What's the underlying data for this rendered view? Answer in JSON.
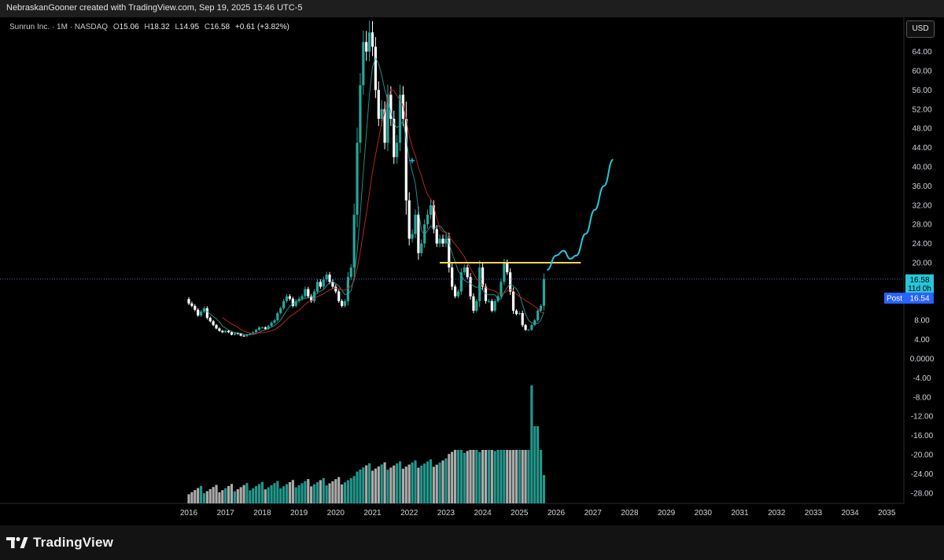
{
  "header": {
    "caption": "NebraskanGooner created with TradingView.com, Sep 19, 2025 15:46 UTC-5"
  },
  "legend": {
    "symbol": "Sunrun Inc. · 1M · NASDAQ",
    "open_label": "O",
    "open": "15.06",
    "high_label": "H",
    "high": "18.32",
    "low_label": "L",
    "low": "14.95",
    "close_label": "C",
    "close": "16.58",
    "change": "+0.61 (+3.82%)"
  },
  "currency_button": "USD",
  "brand": {
    "name": "TradingView",
    "icon": "tradingview-logo-icon"
  },
  "colors": {
    "up": "#26a69a",
    "down": "#ffffff",
    "bg": "#000000",
    "ma_fast": "#26a69a",
    "ma_slow": "#c62828",
    "resistance": "#ffd54f",
    "projection": "#26c6da",
    "last_price_badge": "#26c6da",
    "post_badge": "#2962ff"
  },
  "chart_data": {
    "type": "candlestick",
    "symbol": "Sunrun Inc.",
    "interval": "1M",
    "exchange": "NASDAQ",
    "currency": "USD",
    "y_ticks": [
      64,
      60,
      56,
      52,
      48,
      44,
      40,
      36,
      32,
      28,
      24,
      20,
      16,
      12,
      8,
      4,
      0,
      -4,
      -8,
      -12,
      -16,
      -20,
      -24,
      -28
    ],
    "y_tick_labels": [
      "64.00",
      "60.00",
      "56.00",
      "52.00",
      "48.00",
      "44.00",
      "40.00",
      "36.00",
      "32.00",
      "28.00",
      "24.00",
      "20.00",
      "",
      "",
      "8.00",
      "4.00",
      "0.0000",
      "-4.00",
      "-8.00",
      "-12.00",
      "-16.00",
      "-20.00",
      "-24.00",
      "-28.00"
    ],
    "ylim": [
      -30,
      70
    ],
    "x_labels": [
      "2016",
      "2017",
      "2018",
      "2019",
      "2020",
      "2021",
      "2022",
      "2023",
      "2024",
      "2025",
      "2026",
      "2027",
      "2028",
      "2029",
      "2030",
      "2031",
      "2032",
      "2033",
      "2034",
      "2035"
    ],
    "xlim": [
      2015.7,
      2035.5
    ],
    "last_price": {
      "value": 16.58,
      "label": "16.58",
      "countdown": "11d 0h"
    },
    "post_price": {
      "label": "Post",
      "value": 16.54,
      "value_label": "16.54"
    },
    "resistance_line": {
      "value": 20.0,
      "x_start": 2022.83,
      "x_end": 2026.67
    },
    "candles_by_year": [
      {
        "year": 2016,
        "closes": [
          11.5,
          11,
          10.2,
          9,
          9.8,
          10.5,
          8.5,
          7.8,
          7,
          6.3,
          5.8,
          5.5
        ]
      },
      {
        "year": 2017,
        "closes": [
          5.8,
          5.5,
          5,
          5.3,
          5.2,
          4.8,
          4.7,
          5,
          5.2,
          5.5,
          6,
          6.5
        ]
      },
      {
        "year": 2018,
        "closes": [
          6.5,
          6.2,
          6.8,
          7.5,
          8,
          9.5,
          10.5,
          12,
          13,
          12.5,
          11,
          12
        ]
      },
      {
        "year": 2019,
        "closes": [
          12.5,
          13,
          14.5,
          13,
          12,
          14,
          16,
          15,
          16.5,
          17.5,
          16,
          15
        ]
      },
      {
        "year": 2020,
        "closes": [
          14,
          12,
          11,
          12,
          17,
          19,
          30,
          45,
          57,
          66,
          64,
          68
        ]
      },
      {
        "year": 2021,
        "closes": [
          65,
          56,
          50,
          52,
          45,
          55,
          50,
          42,
          45,
          55,
          50,
          33
        ]
      },
      {
        "year": 2022,
        "closes": [
          25,
          26,
          30,
          22,
          24,
          28,
          30,
          32,
          27,
          24,
          25,
          24
        ]
      },
      {
        "year": 2023,
        "closes": [
          25,
          19,
          15,
          13,
          14,
          18,
          19,
          17,
          13,
          10,
          12,
          19
        ]
      },
      {
        "year": 2024,
        "closes": [
          15,
          12,
          12,
          10,
          12,
          13,
          16,
          20,
          18,
          14,
          10,
          9.3
        ]
      },
      {
        "year": 2025,
        "closes": [
          9.5,
          7,
          6,
          6,
          7,
          8,
          10,
          11,
          16.58
        ]
      }
    ],
    "volume_series": "relative monthly volume bars (no volume scale printed)",
    "ma_fast": {
      "period_label": ""
    },
    "ma_slow": {
      "period_label": ""
    },
    "projection_path": [
      [
        2025.75,
        18.5
      ],
      [
        2026.0,
        21.5
      ],
      [
        2026.2,
        22.5
      ],
      [
        2026.38,
        20.8
      ],
      [
        2026.55,
        21.5
      ],
      [
        2026.8,
        26
      ],
      [
        2027.05,
        31
      ],
      [
        2027.3,
        36
      ],
      [
        2027.55,
        41.5
      ]
    ],
    "marker": {
      "x": 2022.08,
      "y": 41.2,
      "symbol": "+"
    },
    "grid": false,
    "legend_position": "top-left"
  }
}
